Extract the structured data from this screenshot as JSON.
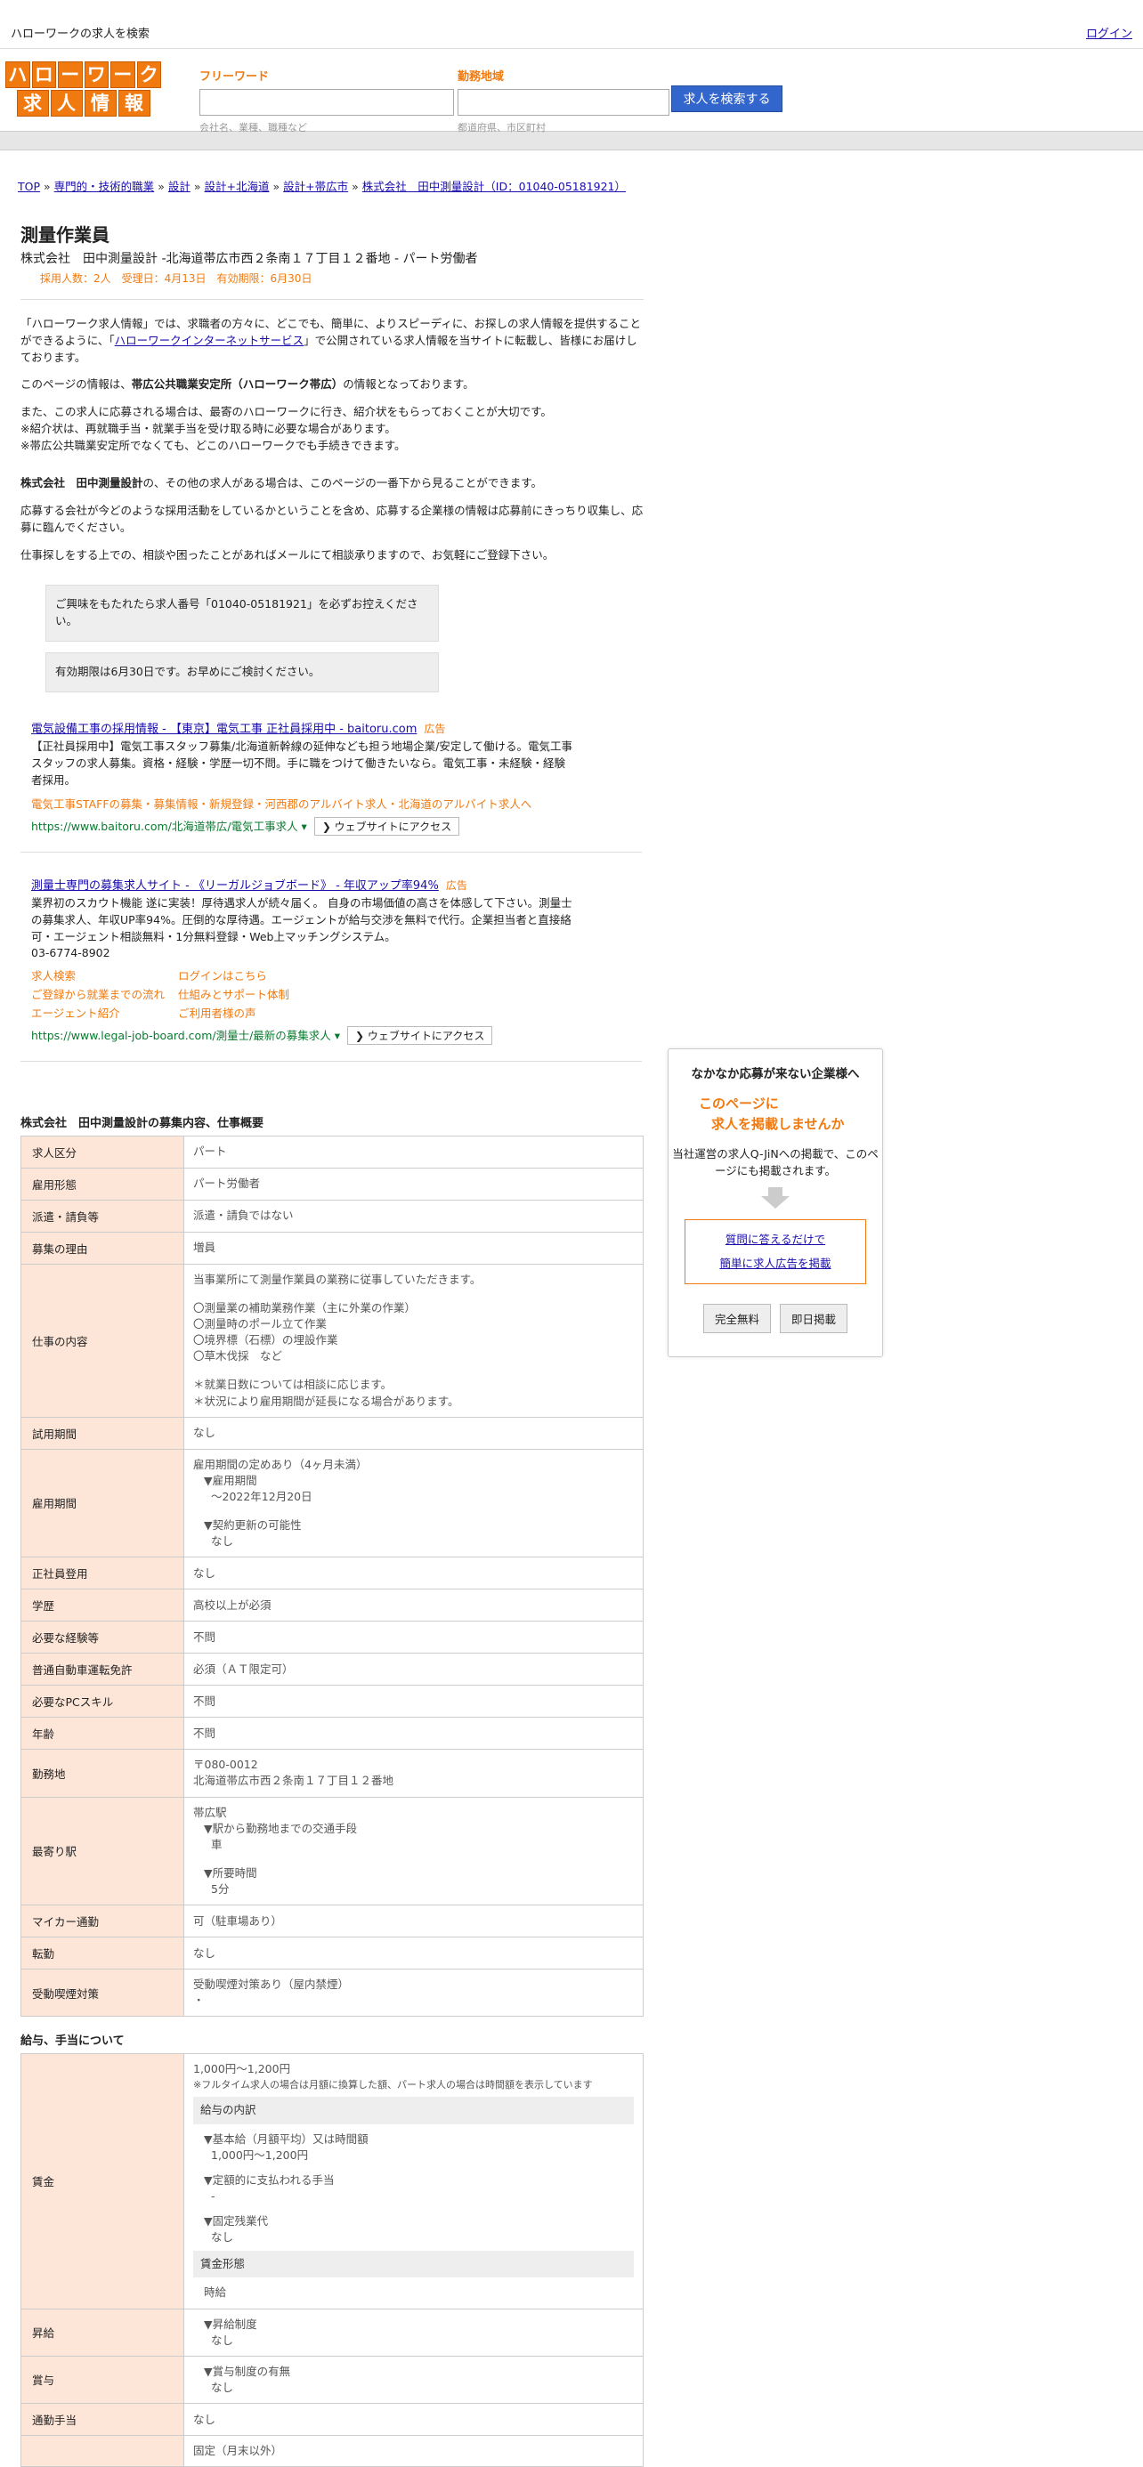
{
  "topbar": {
    "title": "ハローワークの求人を検索",
    "login": "ログイン"
  },
  "logo": {
    "row1": [
      "ハ",
      "ロ",
      "ー",
      "ワ",
      "ー",
      "ク"
    ],
    "row2": [
      "求",
      "人",
      "情",
      "報"
    ]
  },
  "search": {
    "keyword_label": "フリーワード",
    "keyword_hint": "会社名、業種、職種など",
    "area_label": "勤務地域",
    "area_hint": "都道府県、市区町村",
    "button": "求人を検索する"
  },
  "breadcrumb": [
    "TOP",
    "専門的・技術的職業",
    "設計",
    "設計+北海道",
    "設計+帯広市",
    "株式会社　田中測量設計（ID：01040-05181921）"
  ],
  "job": {
    "title": "測量作業員",
    "company_line": "株式会社　田中測量設計 -北海道帯広市西２条南１７丁目１２番地 - パート労働者",
    "meta": "採用人数：2人　受理日：4月13日　有効期限：6月30日"
  },
  "intro": {
    "p1a": "「ハローワーク求人情報」では、求職者の方々に、どこでも、簡単に、よりスピーディに、お探しの求人情報を提供することができるように、「",
    "p1link": "ハローワークインターネットサービス",
    "p1b": "」で公開されている求人情報を当サイトに転載し、皆様にお届けしております。",
    "p2a": "このページの情報は、",
    "p2b": "帯広公共職業安定所（ハローワーク帯広）",
    "p2c": "の情報となっております。",
    "p3": "また、この求人に応募される場合は、最寄のハローワークに行き、紹介状をもらっておくことが大切です。",
    "p3b": "※紹介状は、再就職手当・就業手当を受け取る時に必要な場合があります。",
    "p3c": "※帯広公共職業安定所でなくても、どこのハローワークでも手続きできます。",
    "p4a": "株式会社　田中測量設計",
    "p4b": "の、その他の求人がある場合は、このページの一番下から見ることができます。",
    "p5": "応募する会社が今どのような採用活動をしているかということを含め、応募する企業様の情報は応募前にきっちり収集し、応募に臨んでください。",
    "p6": "仕事探しをする上での、相談や困ったことがあればメールにて相談承りますので、お気軽にご登録下さい。"
  },
  "notices": [
    "ご興味をもたれたら求人番号「01040-05181921」を必ずお控えください。",
    "有効期限は6月30日です。お早めにご検討ください。"
  ],
  "ads": [
    {
      "title": "電気設備工事の採用情報 - 【東京】電気工事 正社員採用中 - baitoru.com",
      "tag": "広告",
      "desc": "【正社員採用中】電気工事スタッフ募集/北海道新幹線の延伸なども担う地場企業/安定して働ける。電気工事スタッフの求人募集。資格・経験・学歴一切不問。手に職をつけて働きたいなら。電気工事・未経験・経験者採用。",
      "links_line": "電気工事STAFFの募集・募集情報・新規登録・河西郡のアルバイト求人・北海道のアルバイト求人へ",
      "url": "https://www.baitoru.com/北海道帯広/電気工事求人",
      "btn": "❯ ウェブサイトにアクセス"
    },
    {
      "title": "測量士専門の募集求人サイト - 《リーガルジョブボード》 - 年収アップ率94%",
      "tag": "広告",
      "desc": "業界初のスカウト機能 遂に実装！厚待遇求人が続々届く。 自身の市場価値の高さを体感して下さい。測量士の募集求人、年収UP率94%。圧倒的な厚待遇。エージェントが給与交渉を無料で代行。企業担当者と直接絡可・エージェント相談無料・1分無料登録・Web上マッチングシステム。",
      "phone": "03-6774-8902",
      "links": [
        "求人検索",
        "ログインはこちら",
        "ご登録から就業までの流れ",
        "仕組みとサポート体制",
        "エージェント紹介",
        "ご利用者様の声"
      ],
      "url": "https://www.legal-job-board.com/測量士/最新の募集求人",
      "btn": "❯ ウェブサイトにアクセス"
    }
  ],
  "table1_title": "株式会社　田中測量設計の募集内容、仕事概要",
  "table1": [
    {
      "h": "求人区分",
      "v": "パート"
    },
    {
      "h": "雇用形態",
      "v": "パート労働者"
    },
    {
      "h": "派遣・請負等",
      "v": "派遣・請負ではない"
    },
    {
      "h": "募集の理由",
      "v": "増員"
    },
    {
      "h": "仕事の内容",
      "lines": [
        "当事業所にて測量作業員の業務に従事していただきます。",
        "",
        "〇測量業の補助業務作業（主に外業の作業）",
        "〇測量時のポール立て作業",
        "〇境界標（石標）の埋設作業",
        "〇草木伐採　など",
        "",
        "＊就業日数については相談に応じます。",
        "＊状況により雇用期間が延長になる場合があります。"
      ]
    },
    {
      "h": "試用期間",
      "v": "なし"
    },
    {
      "h": "雇用期間",
      "lines": [
        "雇用期間の定めあり（4ヶ月未満）",
        "▼雇用期間",
        "〜2022年12月20日",
        "",
        "▼契約更新の可能性",
        "なし"
      ]
    },
    {
      "h": "正社員登用",
      "v": "なし"
    },
    {
      "h": "学歴",
      "v": "高校以上が必須"
    },
    {
      "h": "必要な経験等",
      "v": "不問"
    },
    {
      "h": "普通自動車運転免許",
      "v": "必須（ＡＴ限定可）"
    },
    {
      "h": "必要なPCスキル",
      "v": "不問"
    },
    {
      "h": "年齢",
      "v": "不問"
    },
    {
      "h": "勤務地",
      "lines": [
        "〒080-0012",
        "北海道帯広市西２条南１７丁目１２番地"
      ]
    },
    {
      "h": "最寄り駅",
      "lines": [
        "帯広駅",
        "▼駅から勤務地までの交通手段",
        "車",
        "",
        "▼所要時間",
        "5分"
      ]
    },
    {
      "h": "マイカー通勤",
      "v": "可（駐車場あり）"
    },
    {
      "h": "転勤",
      "v": "なし"
    },
    {
      "h": "受動喫煙対策",
      "lines": [
        "受動喫煙対策あり（屋内禁煙）",
        "・"
      ]
    }
  ],
  "table2_title": "給与、手当について",
  "salary": {
    "h": "賃金",
    "range": "1,000円〜1,200円",
    "note": "※フルタイム求人の場合は月額に換算した額、パート求人の場合は時間額を表示しています",
    "breakdown_title": "給与の内訳",
    "base_label": "▼基本給（月額平均）又は時間額",
    "base_val": "1,000円〜1,200円",
    "fixed_label": "▼定額的に支払われる手当",
    "fixed_val": "-",
    "ot_label": "▼固定残業代",
    "ot_val": "なし",
    "form_title": "賃金形態",
    "form_val": "時給"
  },
  "table2_rest": [
    {
      "h": "昇給",
      "lines": [
        "▼昇給制度",
        "なし"
      ]
    },
    {
      "h": "賞与",
      "lines": [
        "▼賞与制度の有無",
        "なし"
      ]
    },
    {
      "h": "通勤手当",
      "v": "なし"
    },
    {
      "h": "",
      "v": "固定（月末以外）"
    }
  ],
  "side": {
    "title": "なかなか応募が来ない企業様へ",
    "catch1": "このページに",
    "catch2": "求人を掲載しませんか",
    "text": "当社運営の求人Q-JiNへの掲載で、このページにも掲載されます。",
    "link1": "質問に答えるだけで",
    "link2": "簡単に求人広告を掲載",
    "btn1": "完全無料",
    "btn2": "即日掲載"
  }
}
